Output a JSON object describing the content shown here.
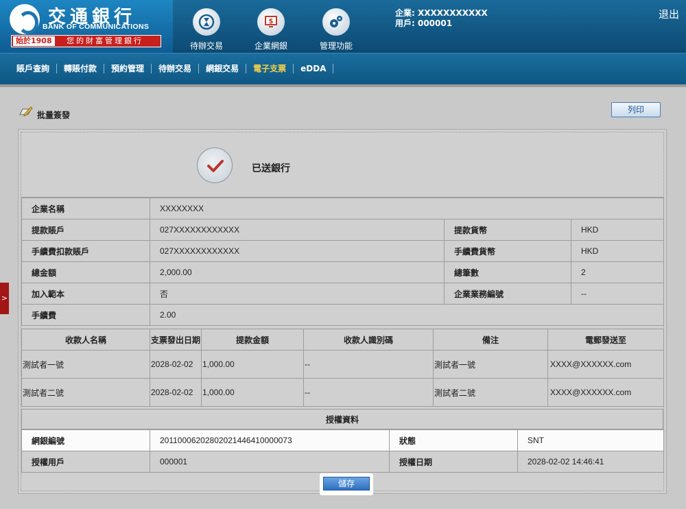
{
  "logo": {
    "name_cn": "交通銀行",
    "name_en": "BANK OF COMMUNICATIONS",
    "since": "始於1908",
    "slogan": "您的財富管理銀行"
  },
  "top_nav": [
    {
      "label": "待辦交易",
      "icon": "hourglass-icon"
    },
    {
      "label": "企業網銀",
      "icon": "monitor-dollar-icon"
    },
    {
      "label": "管理功能",
      "icon": "gears-icon"
    }
  ],
  "user": {
    "company": "企業: XXXXXXXXXXX",
    "user_id": "用戶: 000001"
  },
  "logout_label": "退出",
  "sub_nav": [
    "賬戶查詢",
    "轉賬付款",
    "預約管理",
    "待辦交易",
    "網銀交易",
    "電子支票",
    "eDDA"
  ],
  "sub_nav_active": "電子支票",
  "page": {
    "title": "批量簽發",
    "print_label": "列印",
    "side_tab": ">"
  },
  "status": {
    "text": "已送銀行"
  },
  "info": {
    "company_name_label": "企業名稱",
    "company_name": "XXXXXXXX",
    "withdraw_account_label": "提款賬戶",
    "withdraw_account": "027XXXXXXXXXXXX",
    "withdraw_currency_label": "提款貨幣",
    "withdraw_currency": "HKD",
    "fee_account_label": "手續費扣款賬戶",
    "fee_account": "027XXXXXXXXXXXX",
    "fee_currency_label": "手續費貨幣",
    "fee_currency": "HKD",
    "total_amount_label": "總金額",
    "total_amount": "2,000.00",
    "total_count_label": "總筆數",
    "total_count": "2",
    "add_template_label": "加入範本",
    "add_template": "否",
    "business_no_label": "企業業務編號",
    "business_no": "--",
    "fee_label": "手續費",
    "fee": "2.00"
  },
  "payees": {
    "headers": [
      "收款人名稱",
      "支票發出日期",
      "提款金額",
      "收款人識別碼",
      "備注",
      "電郵發送至"
    ],
    "rows": [
      [
        "測試者一號",
        "2028-02-02",
        "1,000.00",
        "--",
        "測試者一號",
        "XXXX@XXXXXX.com"
      ],
      [
        "測試者二號",
        "2028-02-02",
        "1,000.00",
        "--",
        "測試者二號",
        "XXXX@XXXXXX.com"
      ]
    ]
  },
  "auth": {
    "title": "授權資料",
    "ref_label": "網銀編號",
    "ref": "20110006202802021446410000073",
    "status_label": "狀態",
    "status": "SNT",
    "user_label": "授權用戶",
    "user": "000001",
    "date_label": "授權日期",
    "date": "2028-02-02 14:46:41"
  },
  "save_label": "儲存"
}
